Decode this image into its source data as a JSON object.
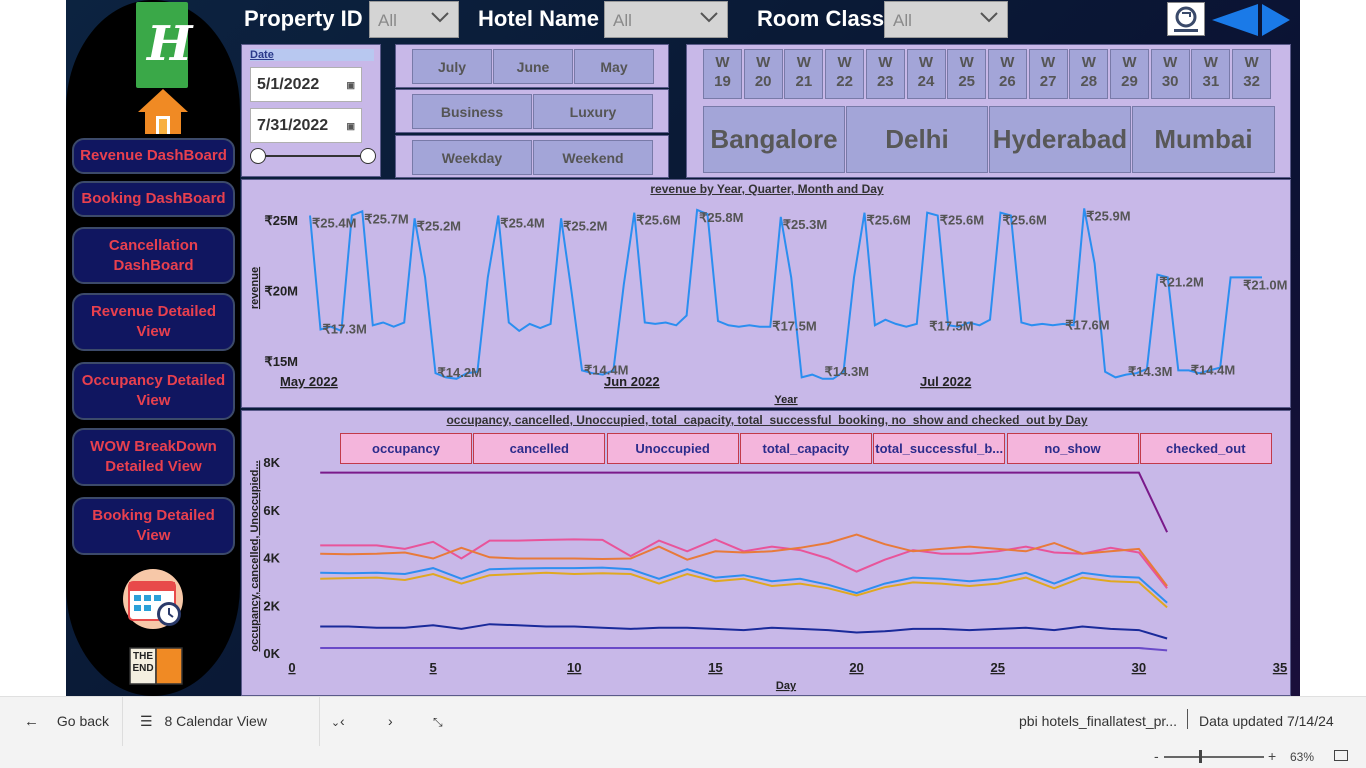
{
  "filters": {
    "property_id": {
      "label": "Property ID",
      "value": "All"
    },
    "hotel_name": {
      "label": "Hotel Name",
      "value": "All"
    },
    "room_class": {
      "label": "Room Class",
      "value": "All"
    }
  },
  "nav": [
    {
      "id": "revenue-dashboard",
      "label": "Revenue DashBoard"
    },
    {
      "id": "booking-dashboard",
      "label": "Booking DashBoard"
    },
    {
      "id": "cancellation-dashboard",
      "label": "Cancellation DashBoard"
    },
    {
      "id": "revenue-detailed",
      "label": "Revenue Detailed View"
    },
    {
      "id": "occupancy-detailed",
      "label": "Occupancy Detailed View"
    },
    {
      "id": "wow-breakdown",
      "label": "WOW BreakDown Detailed View"
    },
    {
      "id": "booking-detailed",
      "label": "Booking Detailed View"
    }
  ],
  "logo_letter": "H",
  "end_icon_text": "THE END",
  "date_slicer": {
    "label": "Date",
    "start": "5/1/2022",
    "end": "7/31/2022",
    "slider_start": 0,
    "slider_end": 1
  },
  "months": [
    "July",
    "June",
    "May"
  ],
  "categories": [
    "Business",
    "Luxury"
  ],
  "daytypes": [
    "Weekday",
    "Weekend"
  ],
  "weeks": [
    {
      "w": "W",
      "n": "19"
    },
    {
      "w": "W",
      "n": "20"
    },
    {
      "w": "W",
      "n": "21"
    },
    {
      "w": "W",
      "n": "22"
    },
    {
      "w": "W",
      "n": "23"
    },
    {
      "w": "W",
      "n": "24"
    },
    {
      "w": "W",
      "n": "25"
    },
    {
      "w": "W",
      "n": "26"
    },
    {
      "w": "W",
      "n": "27"
    },
    {
      "w": "W",
      "n": "28"
    },
    {
      "w": "W",
      "n": "29"
    },
    {
      "w": "W",
      "n": "30"
    },
    {
      "w": "W",
      "n": "31"
    },
    {
      "w": "W",
      "n": "32"
    }
  ],
  "cities": [
    "Bangalore",
    "Delhi",
    "Hyderabad",
    "Mumbai"
  ],
  "chart_data": [
    {
      "type": "line",
      "title": "revenue by Year, Quarter, Month and Day",
      "xlabel": "Year",
      "ylabel": "revenue",
      "y_ticks": [
        "₹25M",
        "₹20M",
        "₹15M"
      ],
      "x_ticks": [
        "May 2022",
        "Jun 2022",
        "Jul 2022"
      ],
      "ylim": [
        14,
        26.5
      ],
      "color": "#2b8ef0",
      "x": [
        1,
        2,
        3,
        4,
        5,
        6,
        7,
        8,
        9,
        10,
        11,
        12,
        13,
        14,
        15,
        16,
        17,
        18,
        19,
        20,
        21,
        22,
        23,
        24,
        25,
        26,
        27,
        28,
        29,
        30,
        31,
        32,
        33,
        34,
        35,
        36,
        37,
        38,
        39,
        40,
        41,
        42,
        43,
        44,
        45,
        46,
        47,
        48,
        49,
        50,
        51,
        52,
        53,
        54,
        55,
        56,
        57,
        58,
        59,
        60,
        61,
        62,
        63,
        64,
        65,
        66,
        67,
        68,
        69,
        70,
        71,
        72,
        73,
        74,
        75,
        76,
        77,
        78,
        79,
        80,
        81,
        82,
        83,
        84,
        85,
        86,
        87,
        88,
        89,
        90,
        91,
        92
      ],
      "values": [
        25.4,
        17.3,
        17.5,
        17.2,
        25.4,
        25.7,
        17.6,
        17.8,
        17.5,
        17.8,
        25.2,
        21,
        14.2,
        13.9,
        13.8,
        14.2,
        14.3,
        21,
        25.4,
        17.8,
        17.2,
        17.7,
        17.4,
        17.7,
        25.2,
        20,
        14.4,
        14.2,
        14.1,
        14.4,
        20.5,
        25.6,
        17.8,
        17.7,
        17.8,
        17.6,
        18.3,
        25.8,
        25.5,
        17.9,
        17.6,
        17.5,
        17.6,
        17.5,
        17.5,
        25.3,
        21,
        13.9,
        14.1,
        13.8,
        13.8,
        14.3,
        21,
        25.6,
        17.6,
        18,
        17.7,
        17.5,
        17.7,
        25.6,
        25.4,
        17.6,
        17.5,
        17.8,
        17.6,
        18,
        25.6,
        25.4,
        17.8,
        17.6,
        17.7,
        17.6,
        17.7,
        17.6,
        25.9,
        22,
        14.3,
        13.9,
        14.1,
        14.2,
        14.5,
        21.2,
        21,
        14.4,
        14.4,
        14.2,
        14.4,
        14.6,
        21,
        21,
        21,
        21
      ],
      "data_labels": [
        {
          "text": "₹25.4M",
          "x": 1,
          "y": 25.4
        },
        {
          "text": "₹17.3M",
          "x": 2,
          "y": 17.3
        },
        {
          "text": "₹25.7M",
          "x": 6,
          "y": 25.7
        },
        {
          "text": "₹25.2M",
          "x": 11,
          "y": 25.2
        },
        {
          "text": "₹14.2M",
          "x": 13,
          "y": 14.2
        },
        {
          "text": "₹25.4M",
          "x": 19,
          "y": 25.4
        },
        {
          "text": "₹25.2M",
          "x": 25,
          "y": 25.2
        },
        {
          "text": "₹14.4M",
          "x": 27,
          "y": 14.4
        },
        {
          "text": "₹25.6M",
          "x": 32,
          "y": 25.6
        },
        {
          "text": "₹25.8M",
          "x": 38,
          "y": 25.8
        },
        {
          "text": "₹25.3M",
          "x": 46,
          "y": 25.3
        },
        {
          "text": "₹17.5M",
          "x": 45,
          "y": 17.5
        },
        {
          "text": "₹14.3M",
          "x": 50,
          "y": 14.3
        },
        {
          "text": "₹25.6M",
          "x": 54,
          "y": 25.6
        },
        {
          "text": "₹17.5M",
          "x": 60,
          "y": 17.5
        },
        {
          "text": "₹25.6M",
          "x": 61,
          "y": 25.6
        },
        {
          "text": "₹25.6M",
          "x": 67,
          "y": 25.6
        },
        {
          "text": "₹17.6M",
          "x": 73,
          "y": 17.6
        },
        {
          "text": "₹25.9M",
          "x": 75,
          "y": 25.9
        },
        {
          "text": "₹14.3M",
          "x": 79,
          "y": 14.3
        },
        {
          "text": "₹21.2M",
          "x": 82,
          "y": 21.2
        },
        {
          "text": "₹14.4M",
          "x": 85,
          "y": 14.4
        },
        {
          "text": "₹21.0M",
          "x": 90,
          "y": 21.0
        }
      ]
    },
    {
      "type": "line",
      "title": "occupancy, cancelled, Unoccupied, total_capacity, total_successful_booking, no_show and checked_out by Day",
      "xlabel": "Day",
      "ylabel": "occupancy, cancelled, Unoccupied...",
      "xlim": [
        0,
        35
      ],
      "ylim": [
        0,
        8000
      ],
      "x_ticks": [
        "0",
        "5",
        "10",
        "15",
        "20",
        "25",
        "30",
        "35"
      ],
      "y_ticks": [
        "8K",
        "6K",
        "4K",
        "2K",
        "0K"
      ],
      "legend_items": [
        "occupancy",
        "cancelled",
        "Unoccupied",
        "total_capacity",
        "total_successful_b...",
        "no_show",
        "checked_out"
      ],
      "x": [
        1,
        2,
        3,
        4,
        5,
        6,
        7,
        8,
        9,
        10,
        11,
        12,
        13,
        14,
        15,
        16,
        17,
        18,
        19,
        20,
        21,
        22,
        23,
        24,
        25,
        26,
        27,
        28,
        29,
        30,
        31
      ],
      "series": [
        {
          "color": "#7a1a8a",
          "values": [
            7600,
            7600,
            7600,
            7600,
            7600,
            7600,
            7600,
            7600,
            7600,
            7600,
            7600,
            7600,
            7600,
            7600,
            7600,
            7600,
            7600,
            7600,
            7600,
            7600,
            7600,
            7600,
            7600,
            7600,
            7600,
            7600,
            7600,
            7600,
            7600,
            7600,
            5100
          ]
        },
        {
          "color": "#e8549a",
          "values": [
            4550,
            4550,
            4550,
            4400,
            4700,
            4000,
            4750,
            4750,
            4780,
            4800,
            4780,
            4100,
            4750,
            4300,
            4800,
            4300,
            4500,
            4350,
            4000,
            3450,
            3950,
            4350,
            4200,
            4200,
            4300,
            4500,
            4250,
            4200,
            4450,
            4250,
            2750
          ]
        },
        {
          "color": "#e87a3a",
          "values": [
            4200,
            4180,
            4200,
            4250,
            4000,
            4450,
            4050,
            4000,
            4000,
            4000,
            3980,
            4000,
            4500,
            3950,
            4300,
            4250,
            4300,
            4450,
            4650,
            5000,
            4600,
            4300,
            4400,
            4500,
            4400,
            4300,
            4650,
            4200,
            4300,
            4400,
            2850
          ]
        },
        {
          "color": "#2e8ef0",
          "values": [
            3400,
            3380,
            3400,
            3350,
            3600,
            3150,
            3550,
            3580,
            3600,
            3600,
            3620,
            3550,
            3150,
            3550,
            3200,
            3300,
            3050,
            3150,
            2900,
            2550,
            2950,
            3200,
            3150,
            3050,
            3150,
            3400,
            2950,
            3400,
            3250,
            3200,
            2150
          ]
        },
        {
          "color": "#e0a820",
          "values": [
            3150,
            3180,
            3200,
            3100,
            3350,
            2950,
            3300,
            3350,
            3400,
            3350,
            3380,
            3350,
            2950,
            3350,
            3050,
            3150,
            2850,
            2950,
            2750,
            2450,
            2800,
            3000,
            2950,
            2850,
            2950,
            3200,
            2750,
            3200,
            3050,
            3000,
            1950
          ]
        },
        {
          "color": "#1a2a9a",
          "values": [
            1150,
            1150,
            1100,
            1100,
            1200,
            1050,
            1250,
            1200,
            1150,
            1150,
            1100,
            1050,
            1100,
            1100,
            1050,
            1000,
            1100,
            1050,
            1000,
            900,
            950,
            1050,
            1050,
            1000,
            1050,
            1100,
            1000,
            1150,
            1050,
            1000,
            650
          ]
        },
        {
          "color": "#6a4ac8",
          "values": [
            250,
            250,
            250,
            250,
            250,
            250,
            250,
            250,
            250,
            250,
            250,
            250,
            250,
            250,
            250,
            250,
            250,
            250,
            250,
            250,
            250,
            250,
            250,
            250,
            250,
            250,
            250,
            250,
            250,
            250,
            150
          ]
        }
      ]
    }
  ],
  "footer": {
    "go_back": "Go back",
    "page_select": "8 Calendar View",
    "report_name": "pbi hotels_finallatest_pr...",
    "data_updated": "Data updated 7/14/24",
    "zoom_minus": "-",
    "zoom_plus": "+",
    "zoom": "63%",
    "zoom_level": 0.35
  }
}
